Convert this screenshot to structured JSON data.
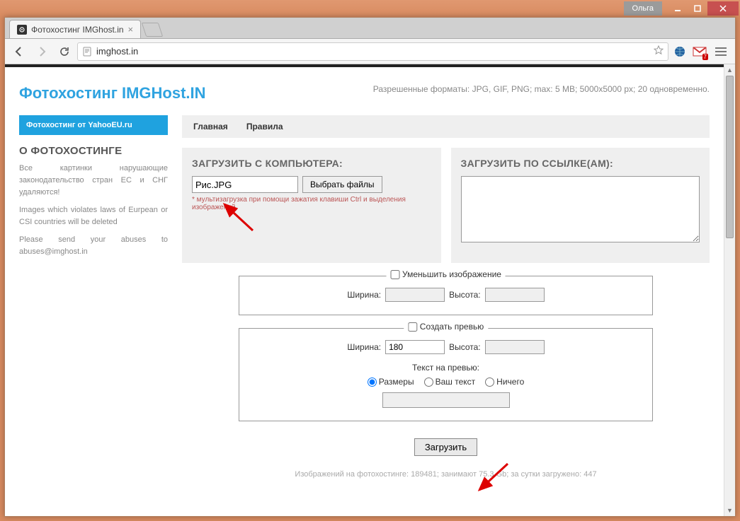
{
  "os": {
    "user": "Ольга"
  },
  "browser": {
    "tab_title": "Фотохостинг IMGhost.in",
    "url": "imghost.in"
  },
  "gmail_badge": "7",
  "site": {
    "title": "Фотохостинг IMGHost.IN",
    "subtitle": "Разрешенные форматы: JPG, GIF, PNG; max: 5 MB; 5000x5000 px; 20 одновременно."
  },
  "sidebar": {
    "tab": "Фотохостинг от YahooEU.ru",
    "heading": "О ФОТОХОСТИНГЕ",
    "p1": "Все картинки нарушающие законодательство стран ЕС и СНГ удаляются!",
    "p2": "Images which violates laws of Eurpean or CSI countries will be deleted",
    "p3": "Please send your abuses to abuses@imghost.in"
  },
  "nav": {
    "main": "Главная",
    "rules": "Правила"
  },
  "upload_computer": {
    "title": "ЗАГРУЗИТЬ С КОМПЬЮТЕРА:",
    "file_value": "Рис.JPG",
    "choose_label": "Выбрать файлы",
    "hint": "* мультизагрузка при помощи зажатия клавиши Ctrl и выделения изображений"
  },
  "upload_url": {
    "title": "ЗАГРУЗИТЬ ПО ССЫЛКЕ(АМ):"
  },
  "resize": {
    "legend": "Уменьшить изображение",
    "width_label": "Ширина:",
    "height_label": "Высота:",
    "width_val": "",
    "height_val": ""
  },
  "preview": {
    "legend": "Создать превью",
    "width_label": "Ширина:",
    "height_label": "Высота:",
    "width_val": "180",
    "height_val": "",
    "text_label": "Текст на превью:",
    "opt_size": "Размеры",
    "opt_custom": "Ваш текст",
    "opt_none": "Ничего"
  },
  "submit_label": "Загрузить",
  "footer": "Изображений на фотохостинге: 189481; занимают 75.3 Gb; за сутки загружено: 447"
}
